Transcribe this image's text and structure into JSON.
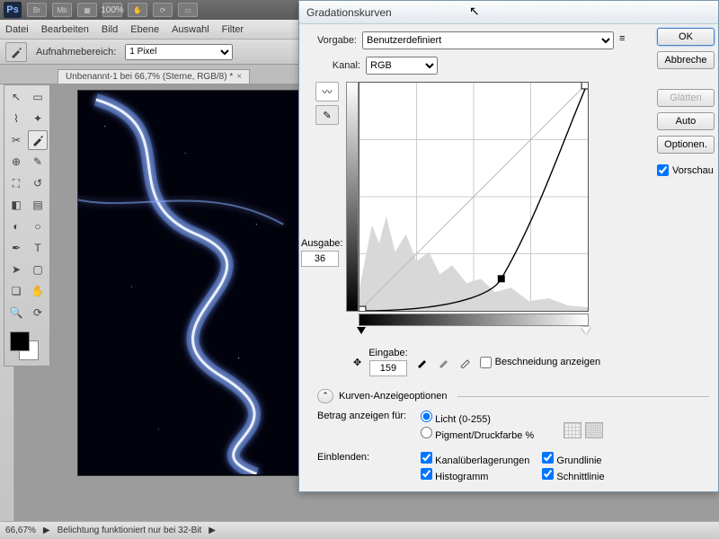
{
  "app": {
    "logo": "Ps",
    "zoom_top": "100%"
  },
  "top_tabs": [
    "Br",
    "Mb"
  ],
  "menu": [
    "Datei",
    "Bearbeiten",
    "Bild",
    "Ebene",
    "Auswahl",
    "Filter"
  ],
  "options": {
    "label": "Aufnahmebereich:",
    "value": "1 Pixel"
  },
  "document": {
    "tab": "Unbenannt-1 bei 66,7% (Sterne, RGB/8) *"
  },
  "status": {
    "zoom": "66,67%",
    "msg": "Belichtung funktioniert nur bei 32-Bit"
  },
  "dialog": {
    "title": "Gradationskurven",
    "preset_label": "Vorgabe:",
    "preset_value": "Benutzerdefiniert",
    "channel_label": "Kanal:",
    "channel_value": "RGB",
    "output_label": "Ausgabe:",
    "output_value": "36",
    "input_label": "Eingabe:",
    "input_value": "159",
    "clip_label": "Beschneidung anzeigen",
    "disclosure": "Kurven-Anzeigeoptionen",
    "amount_label": "Betrag anzeigen für:",
    "amount_opts": [
      "Licht (0-255)",
      "Pigment/Druckfarbe %"
    ],
    "show_label": "Einblenden:",
    "show_opts": [
      "Kanalüberlagerungen",
      "Grundlinie",
      "Histogramm",
      "Schnittlinie"
    ],
    "buttons": {
      "ok": "OK",
      "cancel": "Abbreche",
      "smooth": "Glätten",
      "auto": "Auto",
      "options": "Optionen."
    },
    "preview": "Vorschau"
  },
  "chart_data": {
    "type": "line",
    "title": "Gradationskurve RGB",
    "xlabel": "Eingabe",
    "ylabel": "Ausgabe",
    "xlim": [
      0,
      255
    ],
    "ylim": [
      0,
      255
    ],
    "baseline": [
      [
        0,
        0
      ],
      [
        255,
        255
      ]
    ],
    "curve_points": [
      [
        0,
        0
      ],
      [
        159,
        36
      ],
      [
        255,
        255
      ]
    ],
    "selected_point": {
      "x": 159,
      "y": 36
    }
  }
}
